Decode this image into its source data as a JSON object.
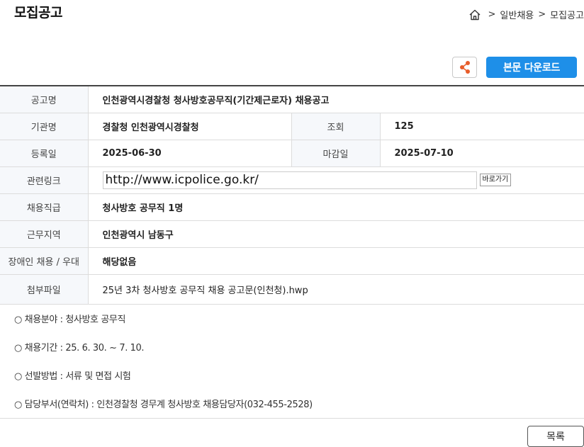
{
  "header": {
    "title": "모집공고",
    "breadcrumb": [
      "일반채용",
      "모집공고"
    ],
    "breadcrumb_sep": ">"
  },
  "toolbar": {
    "download_label": "본문 다운로드",
    "share_icon": "share-icon",
    "share_color": "#e85d2a",
    "accent": "#1e8fe8"
  },
  "info": {
    "title_label": "공고명",
    "title_value": "인천광역시경찰청 청사방호공무직(기간제근로자) 채용공고",
    "org_label": "기관명",
    "org_value": "경찰청 인천광역시경찰청",
    "views_label": "조회",
    "views_value": "125",
    "reg_label": "등록일",
    "reg_value": "2025-06-30",
    "deadline_label": "마감일",
    "deadline_value": "2025-07-10",
    "link_label": "관련링크",
    "link_value": "http://www.icpolice.go.kr/",
    "link_button": "바로가기",
    "job_label": "채용직급",
    "job_value": "청사방호 공무직 1명",
    "area_label": "근무지역",
    "area_value": "인천광역시 남동구",
    "disabled_label": "장애인 채용 / 우대",
    "disabled_value": "해당없음",
    "file_label": "첨부파일",
    "file_value": "25년 3차 청사방호 공무직 채용 공고문(인천청).hwp"
  },
  "notes": [
    "○ 채용분야 : 청사방호 공무직",
    "○ 채용기간 : 25. 6. 30. ~ 7. 10.",
    "○ 선발방법 : 서류 및 면접 시험",
    "○ 담당부서(연락처) : 인천경찰청 경무계 청사방호 채용담당자(032-455-2528)"
  ],
  "footer": {
    "list_label": "목록"
  }
}
